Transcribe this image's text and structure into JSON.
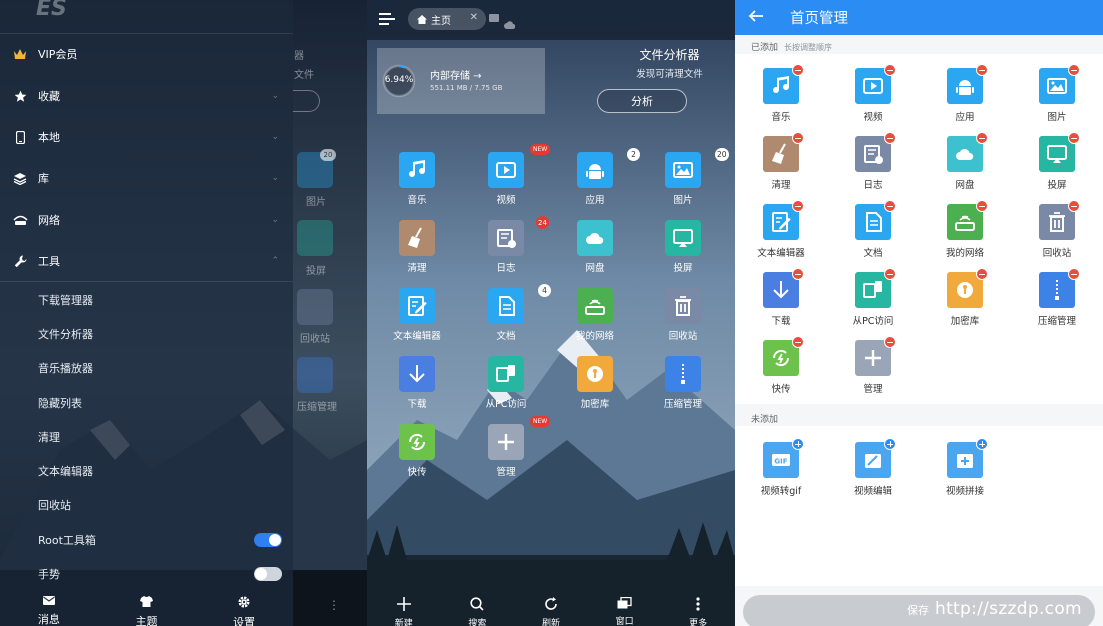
{
  "drawer": {
    "logo": "ES",
    "items": [
      {
        "label": "VIP会员",
        "icon": "crown-icon"
      },
      {
        "label": "收藏",
        "icon": "star-icon"
      },
      {
        "label": "本地",
        "icon": "phone-icon"
      },
      {
        "label": "库",
        "icon": "layers-icon"
      },
      {
        "label": "网络",
        "icon": "network-icon"
      },
      {
        "label": "工具",
        "icon": "wrench-icon"
      }
    ],
    "tools": [
      "下载管理器",
      "文件分析器",
      "音乐播放器",
      "隐藏列表",
      "清理",
      "文本编辑器",
      "回收站"
    ],
    "toggles": [
      {
        "label": "Root工具箱",
        "state": "on"
      },
      {
        "label": "手势",
        "state": "off"
      }
    ],
    "bottom_tabs": [
      {
        "label": "消息",
        "icon": "mail-icon"
      },
      {
        "label": "主题",
        "icon": "shirt-icon"
      },
      {
        "label": "设置",
        "icon": "gear-icon"
      }
    ],
    "behind": {
      "labels": [
        "器",
        "文件",
        "图片",
        "投屏",
        "回收站",
        "压缩管理"
      ],
      "badge": "20"
    }
  },
  "home": {
    "tab_label": "主页",
    "storage": {
      "percent": "6.94%",
      "percent_value": 0.0694,
      "title": "内部存储 →",
      "usage": "551.11 MB / 7.75 GB"
    },
    "analyzer": {
      "title": "文件分析器",
      "subtitle": "发现可清理文件",
      "button": "分析"
    },
    "tiles": [
      {
        "label": "音乐",
        "icon": "music-icon",
        "color": "#2ba7f2"
      },
      {
        "label": "视频",
        "icon": "video-icon",
        "color": "#2ba7f2",
        "badge_new": "NEW"
      },
      {
        "label": "应用",
        "icon": "android-icon",
        "color": "#2ba7f2",
        "badge": "2"
      },
      {
        "label": "图片",
        "icon": "image-icon",
        "color": "#2ba7f2",
        "badge": "20"
      },
      {
        "label": "清理",
        "icon": "broom-icon",
        "color": "#b08a6e"
      },
      {
        "label": "日志",
        "icon": "log-icon",
        "color": "#7a8aa6",
        "badge_red": "24"
      },
      {
        "label": "网盘",
        "icon": "cloud-icon",
        "color": "#3dc1cf"
      },
      {
        "label": "投屏",
        "icon": "cast-icon",
        "color": "#26b6a2"
      },
      {
        "label": "文本编辑器",
        "icon": "edit-icon",
        "color": "#2ba7f2"
      },
      {
        "label": "文档",
        "icon": "doc-icon",
        "color": "#2ba7f2",
        "badge": "4"
      },
      {
        "label": "我的网络",
        "icon": "router-icon",
        "color": "#4cb050"
      },
      {
        "label": "回收站",
        "icon": "trash-icon",
        "color": "#7a8aa6"
      },
      {
        "label": "下载",
        "icon": "download-icon",
        "color": "#4a7ee0"
      },
      {
        "label": "从PC访问",
        "icon": "pc-icon",
        "color": "#26b6a2"
      },
      {
        "label": "加密库",
        "icon": "lock-icon",
        "color": "#f2a93b"
      },
      {
        "label": "压缩管理",
        "icon": "zip-icon",
        "color": "#3d82e6"
      },
      {
        "label": "快传",
        "icon": "share-icon",
        "color": "#6dc24b"
      },
      {
        "label": "管理",
        "icon": "plus-icon",
        "color": "#9aa6b8",
        "badge_new": "NEW"
      }
    ],
    "bottom_nav": [
      {
        "label": "新建",
        "icon": "plus-icon"
      },
      {
        "label": "搜索",
        "icon": "search-icon"
      },
      {
        "label": "刷新",
        "icon": "refresh-icon"
      },
      {
        "label": "窗口",
        "icon": "windows-icon"
      },
      {
        "label": "更多",
        "icon": "more-icon"
      }
    ]
  },
  "manage": {
    "title": "首页管理",
    "added_label": "已添加",
    "added_hint": "长按调整顺序",
    "added": [
      {
        "label": "音乐",
        "icon": "music-icon",
        "color": "#2ba7f2"
      },
      {
        "label": "视频",
        "icon": "video-icon",
        "color": "#2ba7f2"
      },
      {
        "label": "应用",
        "icon": "android-icon",
        "color": "#2ba7f2"
      },
      {
        "label": "图片",
        "icon": "image-icon",
        "color": "#2ba7f2"
      },
      {
        "label": "清理",
        "icon": "broom-icon",
        "color": "#b08a6e"
      },
      {
        "label": "日志",
        "icon": "log-icon",
        "color": "#7a8aa6"
      },
      {
        "label": "网盘",
        "icon": "cloud-icon",
        "color": "#3dc1cf"
      },
      {
        "label": "投屏",
        "icon": "cast-icon",
        "color": "#26b6a2"
      },
      {
        "label": "文本编辑器",
        "icon": "edit-icon",
        "color": "#2ba7f2"
      },
      {
        "label": "文档",
        "icon": "doc-icon",
        "color": "#2ba7f2"
      },
      {
        "label": "我的网络",
        "icon": "router-icon",
        "color": "#4cb050"
      },
      {
        "label": "回收站",
        "icon": "trash-icon",
        "color": "#7a8aa6"
      },
      {
        "label": "下载",
        "icon": "download-icon",
        "color": "#4a7ee0"
      },
      {
        "label": "从PC访问",
        "icon": "pc-icon",
        "color": "#26b6a2"
      },
      {
        "label": "加密库",
        "icon": "lock-icon",
        "color": "#f2a93b"
      },
      {
        "label": "压缩管理",
        "icon": "zip-icon",
        "color": "#3d82e6"
      },
      {
        "label": "快传",
        "icon": "share-icon",
        "color": "#6dc24b"
      },
      {
        "label": "管理",
        "icon": "plus-icon",
        "color": "#9aa6b8"
      }
    ],
    "not_added_label": "未添加",
    "not_added": [
      {
        "label": "视频转gif",
        "icon": "gif-icon",
        "color": "#4aa6f0"
      },
      {
        "label": "视频编辑",
        "icon": "video-edit-icon",
        "color": "#4aa6f0"
      },
      {
        "label": "视频拼接",
        "icon": "video-join-icon",
        "color": "#4aa6f0"
      }
    ],
    "save_label": "保存",
    "watermark": "http://szzdp.com"
  }
}
